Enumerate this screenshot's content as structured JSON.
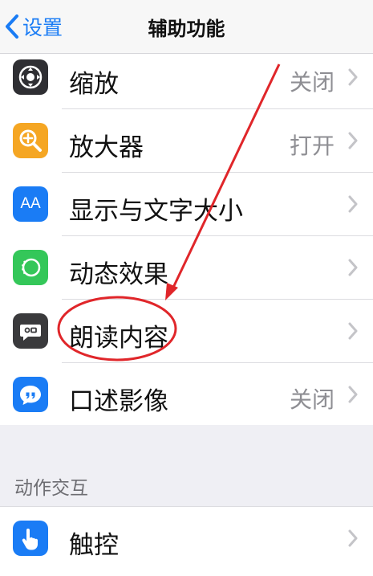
{
  "nav": {
    "back_label": "设置",
    "title": "辅助功能"
  },
  "rows": [
    {
      "label": "缩放",
      "value": "关闭",
      "icon": "zoom-icon",
      "color": "#2f2f33"
    },
    {
      "label": "放大器",
      "value": "打开",
      "icon": "magnifier-icon",
      "color": "#f5a623"
    },
    {
      "label": "显示与文字大小",
      "value": "",
      "icon": "text-size-icon",
      "color": "#1a7cf5"
    },
    {
      "label": "动态效果",
      "value": "",
      "icon": "motion-icon",
      "color": "#34c759"
    },
    {
      "label": "朗读内容",
      "value": "",
      "icon": "speech-icon",
      "color": "#3a3a3c"
    },
    {
      "label": "口述影像",
      "value": "关闭",
      "icon": "audio-description-icon",
      "color": "#1a7cf5"
    }
  ],
  "section2": {
    "header": "动作交互",
    "rows": [
      {
        "label": "触控",
        "value": "",
        "icon": "touch-icon",
        "color": "#1a7cf5"
      }
    ]
  },
  "icons": {
    "text_size_glyph": "AA"
  },
  "annotation_color": "#e0262a"
}
